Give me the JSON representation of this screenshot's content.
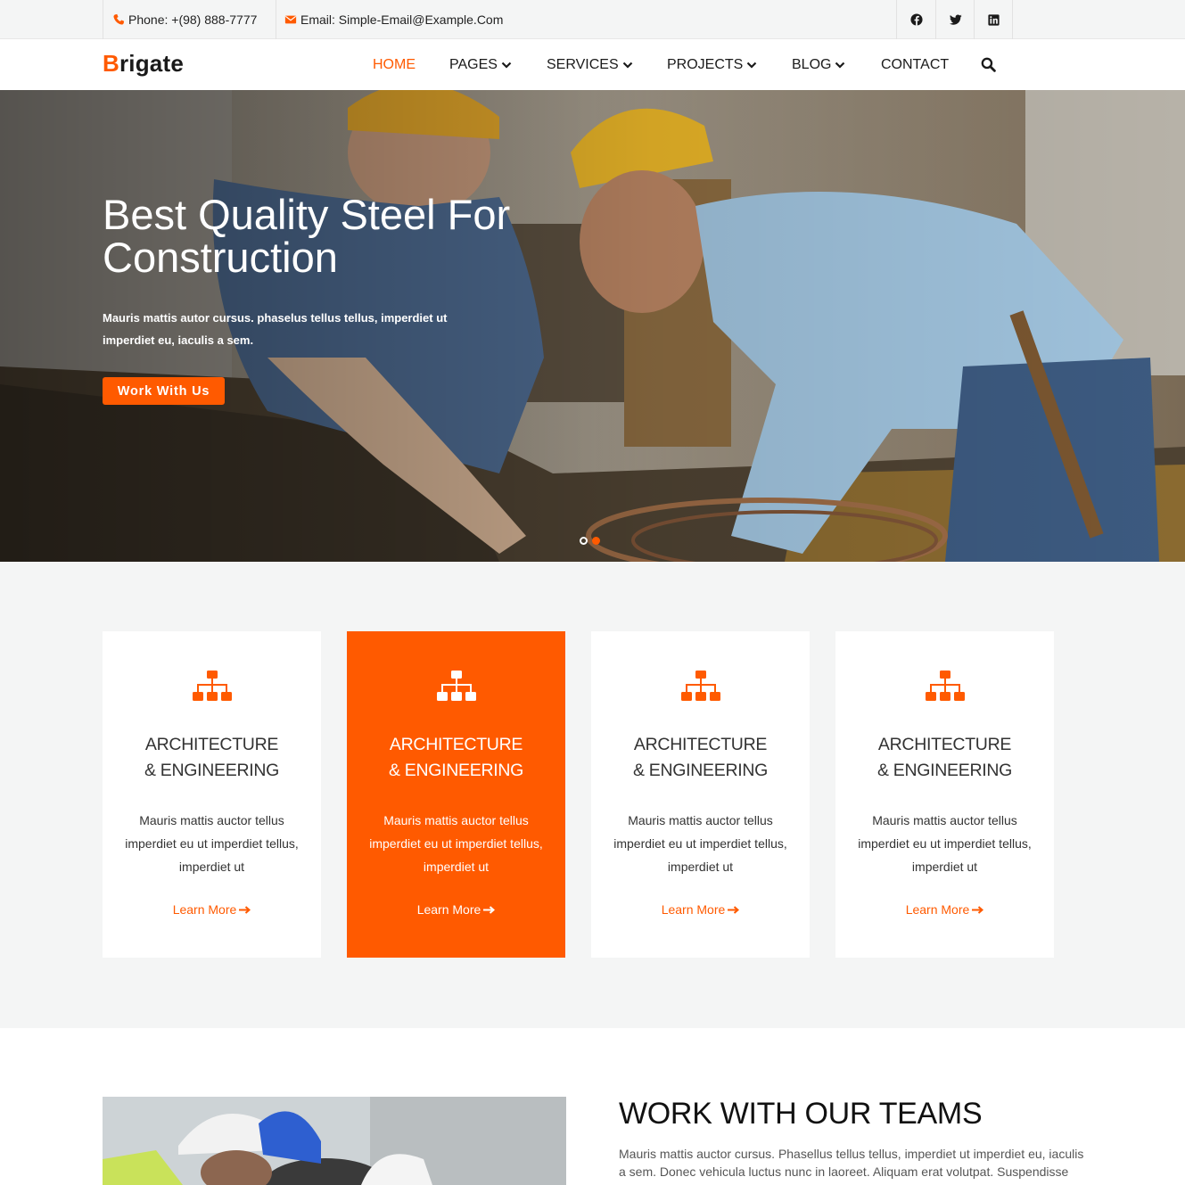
{
  "topbar": {
    "phone": "Phone: +(98) 888-7777",
    "email": "Email: Simple-Email@Example.Com",
    "social_icons": [
      "facebook-icon",
      "twitter-icon",
      "linkedin-icon"
    ]
  },
  "header": {
    "logo_first": "B",
    "logo_rest": "rigate",
    "nav": [
      {
        "label": "HOME",
        "active": true,
        "dropdown": false
      },
      {
        "label": "PAGES",
        "active": false,
        "dropdown": true
      },
      {
        "label": "SERVICES",
        "active": false,
        "dropdown": true
      },
      {
        "label": "PROJECTS",
        "active": false,
        "dropdown": true
      },
      {
        "label": "BLOG",
        "active": false,
        "dropdown": true
      },
      {
        "label": "CONTACT",
        "active": false,
        "dropdown": false
      }
    ],
    "search_icon": "search-icon"
  },
  "hero": {
    "title": "Best Quality Steel For Construction",
    "text": "Mauris mattis autor cursus. phaselus tellus tellus, imperdiet ut imperdiet eu, iaculis a sem.",
    "button": "Work With Us",
    "slides": 2,
    "active_slide": 2
  },
  "services": [
    {
      "title_line1": "ARCHITECTURE",
      "title_line2": "& ENGINEERING",
      "text": "Mauris mattis auctor tellus imperdiet eu ut imperdiet tellus, imperdiet ut",
      "link": "Learn More",
      "highlighted": false,
      "icon": "sitemap-icon"
    },
    {
      "title_line1": "ARCHITECTURE",
      "title_line2": "& ENGINEERING",
      "text": "Mauris mattis auctor tellus imperdiet eu ut imperdiet tellus, imperdiet ut",
      "link": "Learn More",
      "highlighted": true,
      "icon": "sitemap-icon"
    },
    {
      "title_line1": "ARCHITECTURE",
      "title_line2": "& ENGINEERING",
      "text": "Mauris mattis auctor tellus imperdiet eu ut imperdiet tellus, imperdiet ut",
      "link": "Learn More",
      "highlighted": false,
      "icon": "sitemap-icon"
    },
    {
      "title_line1": "ARCHITECTURE",
      "title_line2": "& ENGINEERING",
      "text": "Mauris mattis auctor tellus imperdiet eu ut imperdiet tellus, imperdiet ut",
      "link": "Learn More",
      "highlighted": false,
      "icon": "sitemap-icon"
    }
  ],
  "team": {
    "title": "WORK WITH OUR TEAMS",
    "text": "Mauris mattis auctor cursus. Phasellus tellus tellus, imperdiet ut imperdiet eu, iaculis a sem. Donec vehicula luctus nunc in laoreet. Aliquam erat volutpat. Suspendisse"
  },
  "colors": {
    "accent": "#ff5a00",
    "topbar_bg": "#f4f5f5",
    "section_bg": "#f4f5f5",
    "text_dark": "#1a1a1a"
  }
}
